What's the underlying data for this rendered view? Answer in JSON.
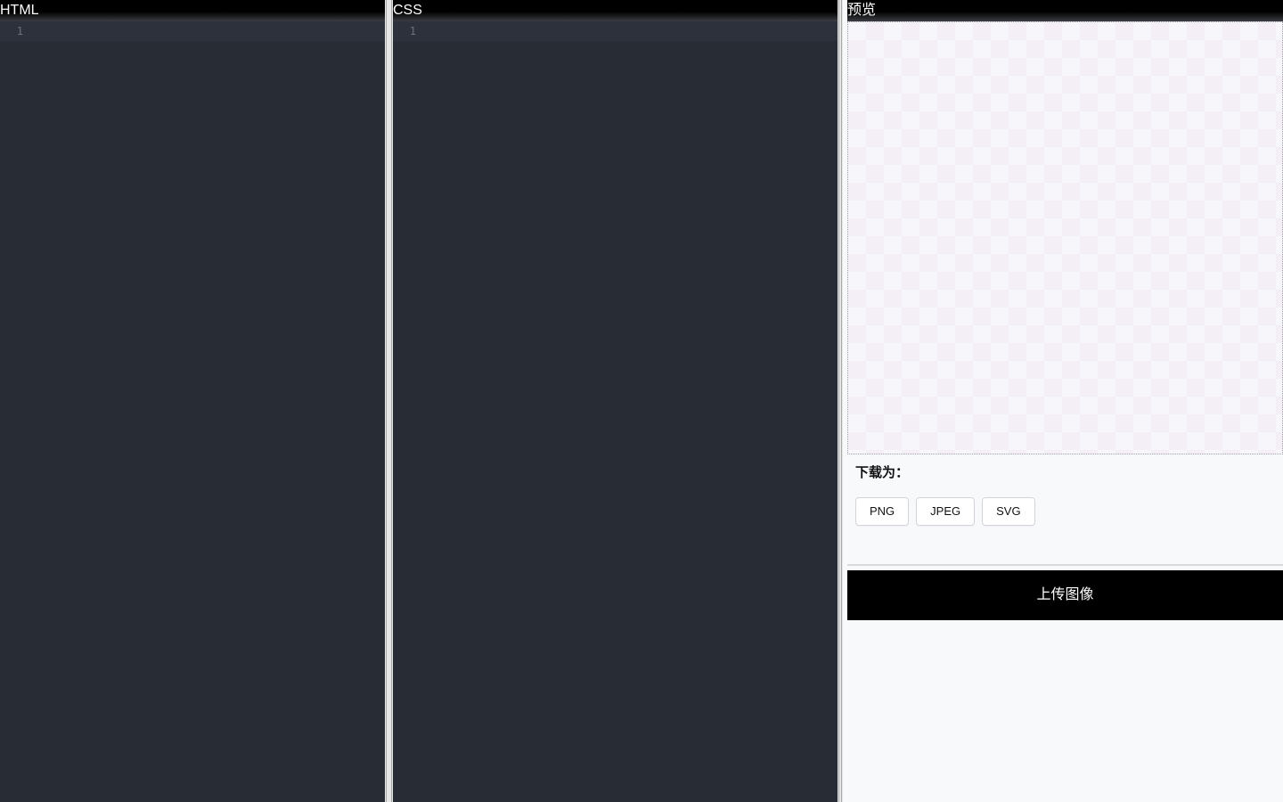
{
  "html_editor": {
    "title": "HTML",
    "line_number": "1"
  },
  "css_editor": {
    "title": "CSS",
    "line_number": "1"
  },
  "preview": {
    "title": "预览",
    "download_label": "下载为：",
    "download_buttons": [
      "PNG",
      "JPEG",
      "SVG"
    ],
    "upload_label": "上传图像"
  },
  "colors": {
    "editor_bg": "#282c34",
    "active_line_bg": "#2c313c",
    "header_bg": "#000000",
    "preview_bg": "#f8f9fb",
    "upload_bg": "#000000"
  }
}
